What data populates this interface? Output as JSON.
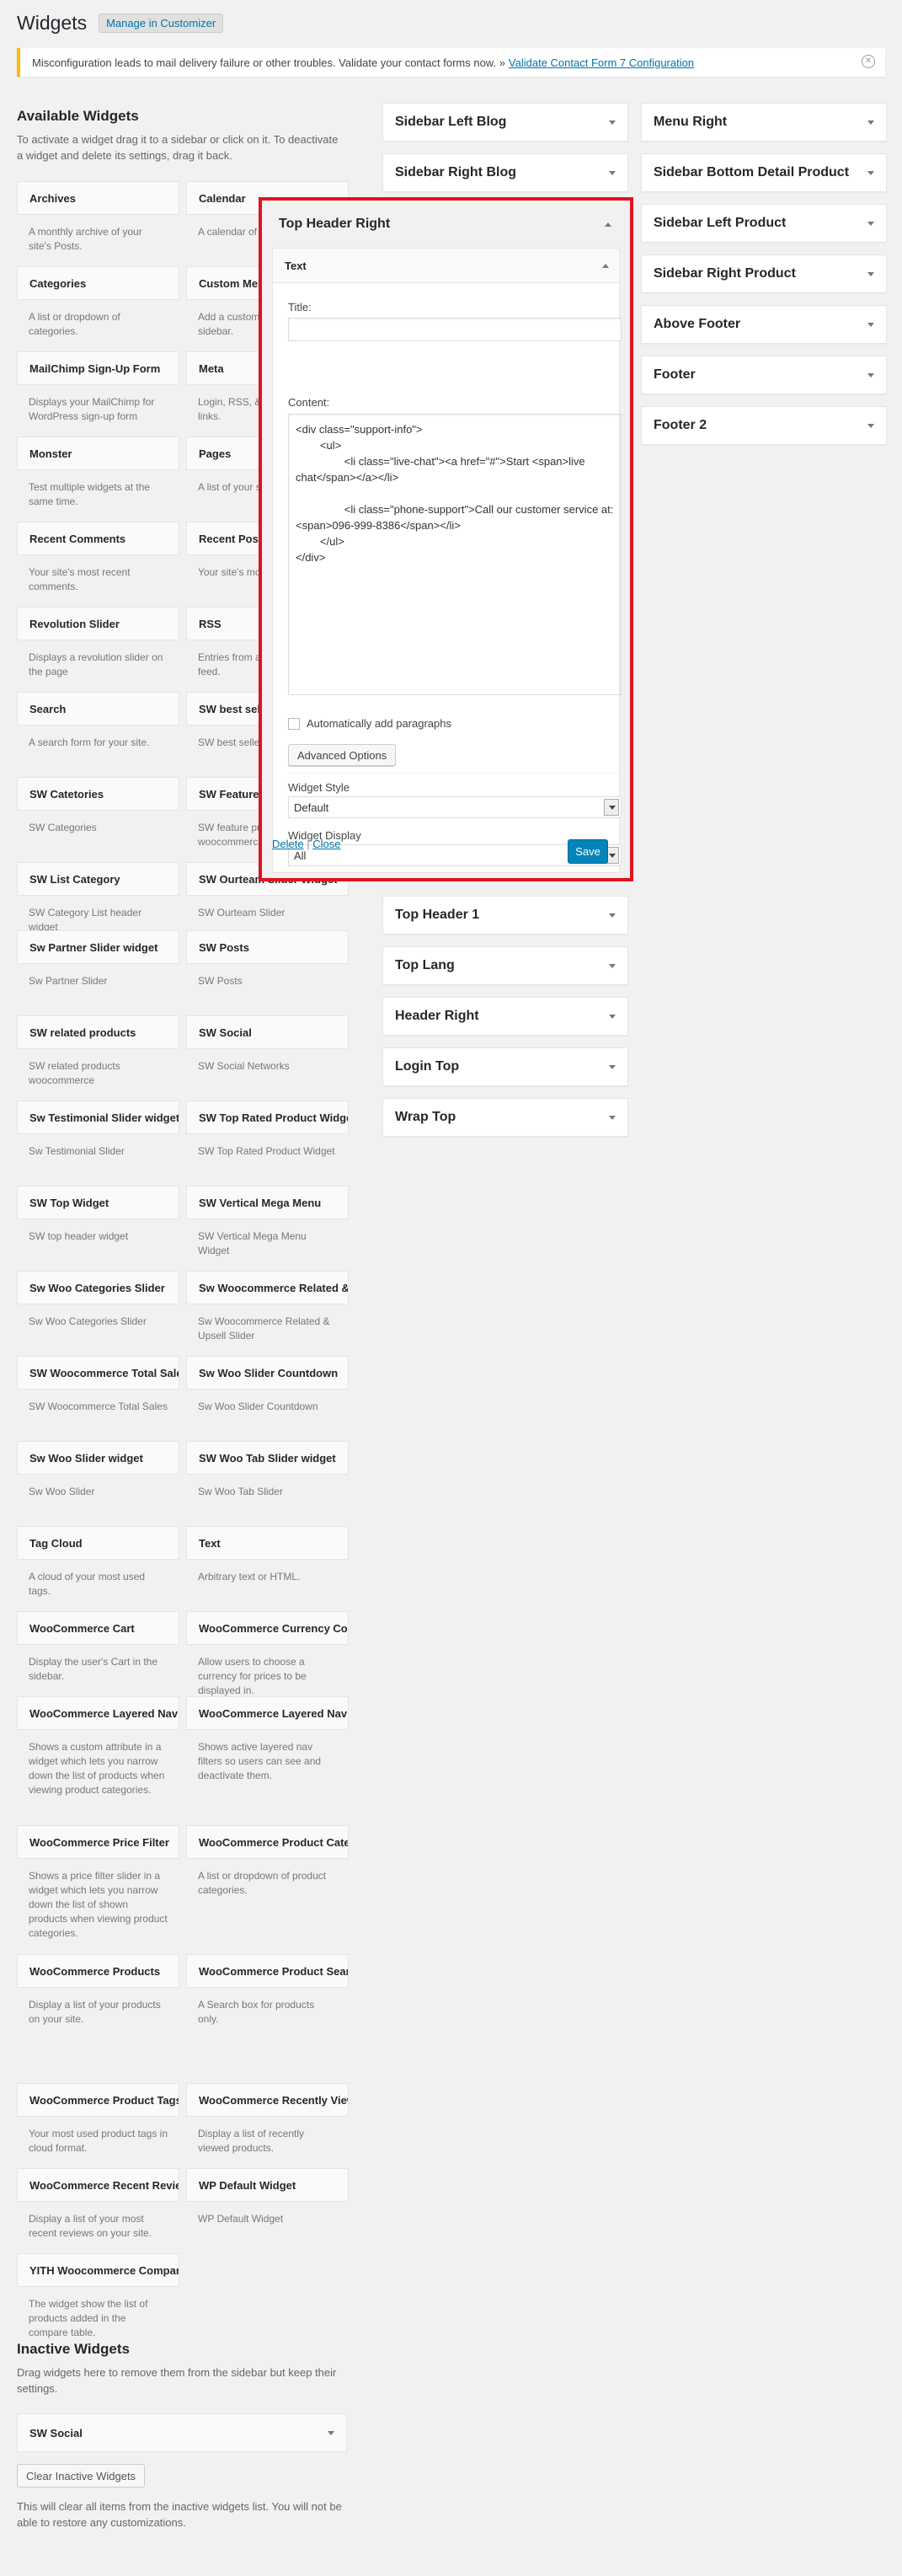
{
  "header": {
    "title": "Widgets",
    "manage_label": "Manage in Customizer"
  },
  "notice": {
    "text": "Misconfiguration leads to mail delivery failure or other troubles. Validate your contact forms now. »",
    "link": "Validate Contact Form 7 Configuration"
  },
  "available": {
    "title": "Available Widgets",
    "desc": "To activate a widget drag it to a sidebar or click on it. To deactivate a widget and delete its settings, drag it back.",
    "widgets": [
      {
        "title": "Archives",
        "desc": "A monthly archive of your site's Posts."
      },
      {
        "title": "Calendar",
        "desc": "A calendar of your site's Posts."
      },
      {
        "title": "Categories",
        "desc": "A list or dropdown of categories."
      },
      {
        "title": "Custom Menu",
        "desc": "Add a custom menu to your sidebar."
      },
      {
        "title": "MailChimp Sign-Up Form",
        "desc": "Displays your MailChimp for WordPress sign-up form"
      },
      {
        "title": "Meta",
        "desc": "Login, RSS, & WordPress.org links."
      },
      {
        "title": "Monster",
        "desc": "Test multiple widgets at the same time."
      },
      {
        "title": "Pages",
        "desc": "A list of your site's Pages."
      },
      {
        "title": "Recent Comments",
        "desc": "Your site's most recent comments."
      },
      {
        "title": "Recent Posts",
        "desc": "Your site's most recent Posts."
      },
      {
        "title": "Revolution Slider",
        "desc": "Displays a revolution slider on the page"
      },
      {
        "title": "RSS",
        "desc": "Entries from any RSS or Atom feed."
      },
      {
        "title": "Search",
        "desc": "A search form for your site."
      },
      {
        "title": "SW best seller",
        "desc": "SW best seller woocommerce"
      },
      {
        "title": "SW Catetories",
        "desc": "SW Categories"
      },
      {
        "title": "SW Feature Product",
        "desc": "SW feature product woocommerce"
      },
      {
        "title": "SW List Category",
        "desc": "SW Category List header widget"
      },
      {
        "title": "SW Ourteam Slider Widget",
        "desc": "SW Ourteam Slider"
      },
      {
        "title": "Sw Partner Slider widget",
        "desc": "Sw Partner Slider"
      },
      {
        "title": "SW Posts",
        "desc": "SW Posts"
      },
      {
        "title": "SW related products",
        "desc": "SW related products woocommerce"
      },
      {
        "title": "SW Social",
        "desc": "SW Social Networks"
      },
      {
        "title": "Sw Testimonial Slider widget",
        "desc": "Sw Testimonial Slider"
      },
      {
        "title": "SW Top Rated Product Widget",
        "desc": "SW Top Rated Product Widget"
      },
      {
        "title": "SW Top Widget",
        "desc": "SW top header widget"
      },
      {
        "title": "SW Vertical Mega Menu",
        "desc": "SW Vertical Mega Menu Widget"
      },
      {
        "title": "Sw Woo Categories Slider",
        "desc": "Sw Woo Categories Slider"
      },
      {
        "title": "Sw Woocommerce Related & Upsell",
        "desc": "Sw Woocommerce Related & Upsell Slider"
      },
      {
        "title": "SW Woocommerce Total Sales",
        "desc": "SW Woocommerce Total Sales"
      },
      {
        "title": "Sw Woo Slider Countdown",
        "desc": "Sw Woo Slider Countdown"
      },
      {
        "title": "Sw Woo Slider widget",
        "desc": "Sw Woo Slider"
      },
      {
        "title": "SW Woo Tab Slider widget",
        "desc": "Sw Woo Tab Slider"
      },
      {
        "title": "Tag Cloud",
        "desc": "A cloud of your most used tags."
      },
      {
        "title": "Text",
        "desc": "Arbitrary text or HTML."
      },
      {
        "title": "WooCommerce Cart",
        "desc": "Display the user's Cart in the sidebar."
      },
      {
        "title": "WooCommerce Currency Converter",
        "desc": "Allow users to choose a currency for prices to be displayed in."
      },
      {
        "title": "WooCommerce Layered Nav",
        "desc": "Shows a custom attribute in a widget which lets you narrow down the list of products when viewing product categories."
      },
      {
        "title": "WooCommerce Layered Nav Filters",
        "desc": "Shows active layered nav filters so users can see and deactivate them."
      },
      {
        "title": "WooCommerce Price Filter",
        "desc": "Shows a price filter slider in a widget which lets you narrow down the list of shown products when viewing product categories."
      },
      {
        "title": "WooCommerce Product Categories",
        "desc": "A list or dropdown of product categories."
      },
      {
        "title": "WooCommerce Products",
        "desc": "Display a list of your products on your site."
      },
      {
        "title": "WooCommerce Product Search",
        "desc": "A Search box for products only."
      },
      {
        "title": "WooCommerce Product Tags",
        "desc": "Your most used product tags in cloud format."
      },
      {
        "title": "WooCommerce Recently Viewed",
        "desc": "Display a list of recently viewed products."
      },
      {
        "title": "WooCommerce Recent Reviews",
        "desc": "Display a list of your most recent reviews on your site."
      },
      {
        "title": "WP Default Widget",
        "desc": "WP Default Widget"
      },
      {
        "title": "YITH Woocommerce Compare Widget",
        "desc": "The widget show the list of products added in the compare table."
      }
    ]
  },
  "sidebars_col1_top": [
    "Sidebar Left Blog",
    "Sidebar Right Blog"
  ],
  "open_sidebar": {
    "name": "Top Header Right",
    "widget_title": "Text",
    "title_label": "Title:",
    "title_value": "",
    "content_label": "Content:",
    "content_value": "<div class=\"support-info\">\n        <ul>\n                <li class=\"live-chat\"><a href=\"#\">Start <span>live chat</span></a></li>\n\n                <li class=\"phone-support\">Call our customer service at: <span>096-999-8386</span></li>\n        </ul>\n</div>",
    "autop_label": "Automatically add paragraphs",
    "advanced_label": "Advanced Options",
    "style_label": "Widget Style",
    "style_value": "Default",
    "display_label": "Widget Display",
    "display_value": "All",
    "delete_label": "Delete",
    "close_label": "Close",
    "save_label": "Save"
  },
  "sidebars_col1_bottom": [
    "Top Header 1",
    "Top Lang",
    "Header Right",
    "Login Top",
    "Wrap Top"
  ],
  "sidebars_col2": [
    "Menu Right",
    "Sidebar Bottom Detail Product",
    "Sidebar Left Product",
    "Sidebar Right Product",
    "Above Footer",
    "Footer",
    "Footer 2"
  ],
  "inactive": {
    "title": "Inactive Widgets",
    "desc": "Drag widgets here to remove them from the sidebar but keep their settings.",
    "widget": "SW Social",
    "clear_label": "Clear Inactive Widgets",
    "clear_desc": "This will clear all items from the inactive widgets list. You will not be able to restore any customizations."
  }
}
